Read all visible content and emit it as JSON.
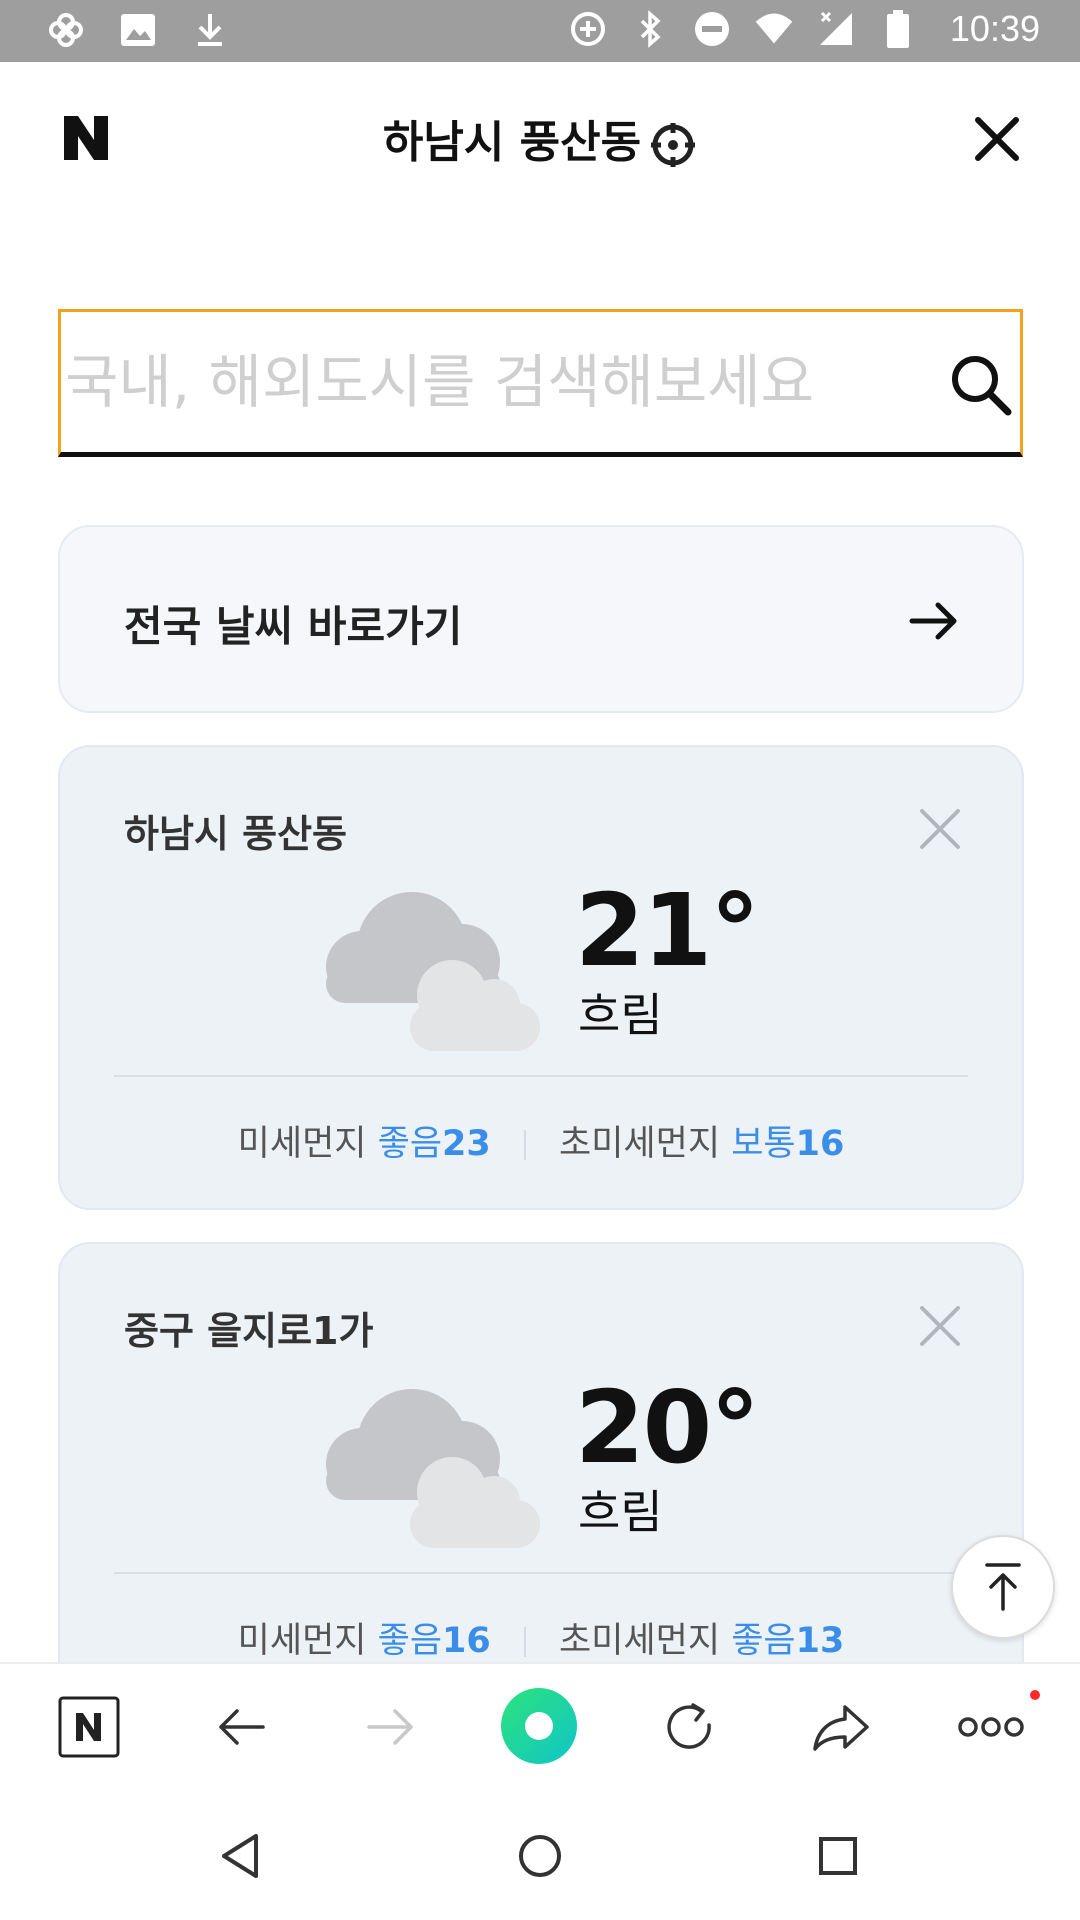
{
  "status_bar": {
    "time": "10:39",
    "left_icons": [
      "pinwheel-icon",
      "image-icon",
      "download-icon"
    ],
    "right_icons": [
      "data-saver-icon",
      "bluetooth-icon",
      "dnd-icon",
      "wifi-icon",
      "signal-icon",
      "battery-icon"
    ]
  },
  "header": {
    "logo_text": "N",
    "title": "하남시 풍산동",
    "location_icon": "crosshair-icon",
    "close_icon": "close-icon"
  },
  "search": {
    "placeholder": "국내, 해외도시를 검색해보세요",
    "value": ""
  },
  "shortcut": {
    "label": "전국 날씨 바로가기"
  },
  "cards": [
    {
      "location": "하남시 풍산동",
      "temp": "21°",
      "condition": "흐림",
      "fine_dust_label": "미세먼지",
      "fine_dust_status": "좋음",
      "fine_dust_value": "23",
      "ultra_dust_label": "초미세먼지",
      "ultra_dust_status": "보통",
      "ultra_dust_value": "16"
    },
    {
      "location": "중구 을지로1가",
      "temp": "20°",
      "condition": "흐림",
      "fine_dust_label": "미세먼지",
      "fine_dust_status": "좋음",
      "fine_dust_value": "16",
      "ultra_dust_label": "초미세먼지",
      "ultra_dust_status": "좋음",
      "ultra_dust_value": "13"
    }
  ],
  "toolbar": {
    "items": [
      "naver-home-icon",
      "back-arrow-icon",
      "forward-arrow-icon",
      "green-dot-icon",
      "refresh-icon",
      "share-icon",
      "more-icon"
    ]
  },
  "colors": {
    "accent_orange": "#f3a21a",
    "dust_blue": "#3b8ee8",
    "green": "#19d27c"
  }
}
